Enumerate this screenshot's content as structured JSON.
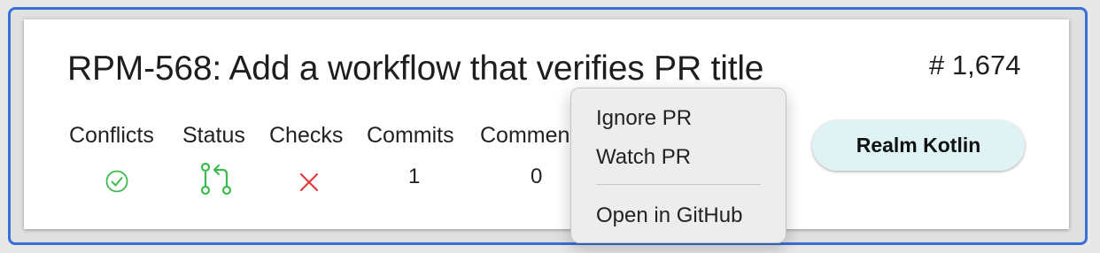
{
  "pr": {
    "title": "RPM-568: Add a workflow that verifies PR title",
    "number": "# 1,674"
  },
  "columns": {
    "conflicts": {
      "label": "Conflicts",
      "icon": "check-circle-icon",
      "status_color": "#3dbb4f"
    },
    "status": {
      "label": "Status",
      "icon": "pull-request-icon",
      "status_color": "#3dbb4f"
    },
    "checks": {
      "label": "Checks",
      "icon": "x-icon",
      "status_color": "#e23b3b"
    },
    "commits": {
      "label": "Commits",
      "value": "1"
    },
    "comments": {
      "label": "Commen",
      "value": "0"
    }
  },
  "repo_badge": {
    "label": "Realm Kotlin",
    "background": "#dff3f5"
  },
  "context_menu": {
    "items": [
      {
        "label": "Ignore PR"
      },
      {
        "label": "Watch PR"
      },
      {
        "label": "Open in GitHub"
      }
    ]
  },
  "colors": {
    "selection_border": "#3a6fd8"
  }
}
